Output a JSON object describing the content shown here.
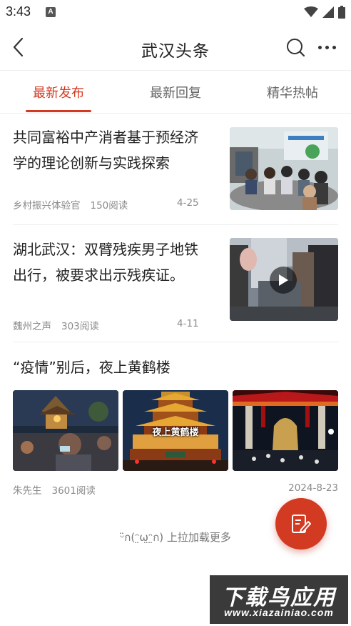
{
  "status_bar": {
    "time": "3:43",
    "notif_letter": "A"
  },
  "header": {
    "title": "武汉头条"
  },
  "tabs": [
    {
      "label": "最新发布"
    },
    {
      "label": "最新回复"
    },
    {
      "label": "精华热帖"
    }
  ],
  "articles": [
    {
      "title": "共同富裕中产消者基于预经济学的理论创新与实践探索",
      "author": "乡村振兴体验官",
      "reads": "150阅读",
      "date": "4-25"
    },
    {
      "title": "湖北武汉：双臂残疾男子地铁出行，被要求出示残疾证。",
      "author": "魏州之声",
      "reads": "303阅读",
      "date": "4-11"
    }
  ],
  "gallery_article": {
    "title": "“疫情”别后，夜上黄鹤楼",
    "author": "朱先生",
    "reads": "3601阅读",
    "date": "2024-8-23",
    "image_caption": "夜上黄鹤楼"
  },
  "load_more": "ᵕ̈ก(ᵔ̤ω̤ᵔ̤ก) 上拉加载更多",
  "watermark": {
    "text": "下载鸟应用",
    "url": "www.xiazainiao.com"
  },
  "colors": {
    "accent": "#d23a22"
  }
}
